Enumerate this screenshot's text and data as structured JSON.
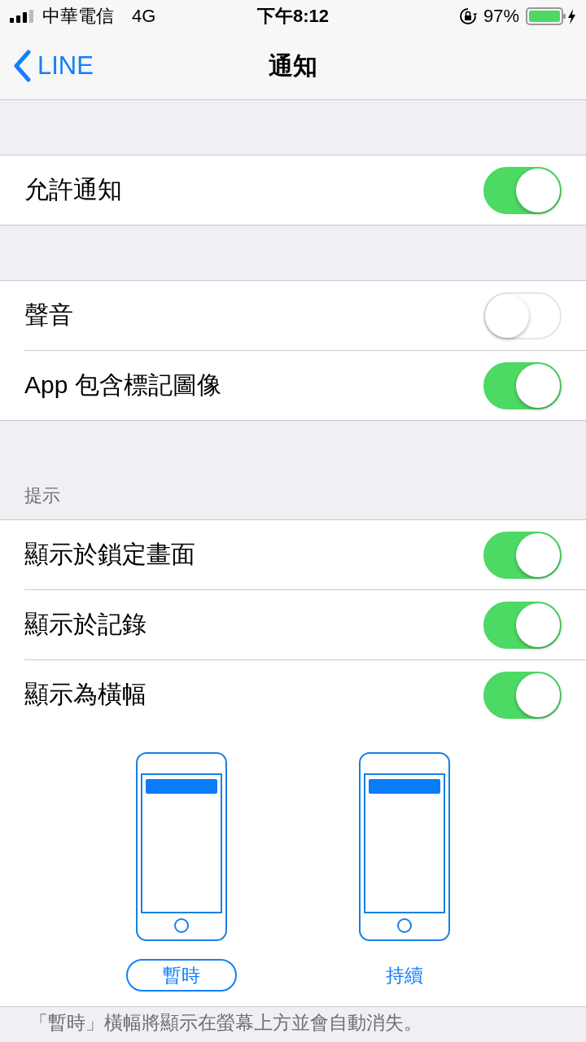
{
  "status_bar": {
    "carrier": "中華電信",
    "network": "4G",
    "time": "下午8:12",
    "battery": "97%"
  },
  "nav": {
    "back": "LINE",
    "title": "通知"
  },
  "sections": [
    {
      "rows": [
        {
          "label": "允許通知",
          "on": true
        }
      ]
    },
    {
      "rows": [
        {
          "label": "聲音",
          "on": false
        },
        {
          "label": "App 包含標記圖像",
          "on": true
        }
      ]
    },
    {
      "header": "提示",
      "rows": [
        {
          "label": "顯示於鎖定畫面",
          "on": true
        },
        {
          "label": "顯示於記錄",
          "on": true
        },
        {
          "label": "顯示為橫幅",
          "on": true
        }
      ]
    }
  ],
  "banner_styles": [
    {
      "label": "暫時",
      "selected": true
    },
    {
      "label": "持續",
      "selected": false
    }
  ],
  "footer": "「暫時」橫幅將顯示在螢幕上方並會自動消失。"
}
